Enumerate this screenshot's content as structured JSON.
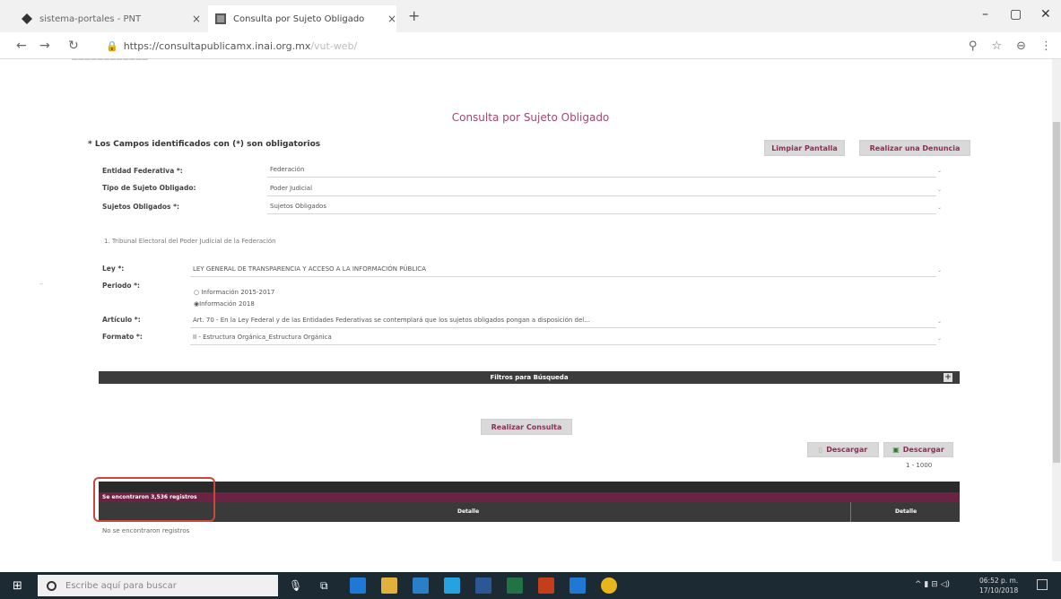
{
  "browser": {
    "tabs": [
      {
        "label": "sistema-portales - PNT"
      },
      {
        "label": "Consulta por Sujeto Obligado"
      }
    ],
    "url_main": "https://consultapublicamx.inai.org.mx",
    "url_path": "/vut-web/"
  },
  "page": {
    "title": "Consulta por Sujeto Obligado",
    "required_note": "* Los Campos identificados con (*) son obligatorios",
    "clear_button": "Limpiar Pantalla",
    "report_button": "Realizar una Denuncia",
    "fields": {
      "entidad": {
        "label": "Entidad Federativa *:",
        "value": "Federación"
      },
      "tipo": {
        "label": "Tipo de Sujeto Obligado:",
        "value": "Poder Judicial"
      },
      "sujetos": {
        "label": "Sujetos Obligados *:",
        "value": "Sujetos Obligados"
      },
      "ley": {
        "label": "Ley *:",
        "value": "LEY GENERAL DE TRANSPARENCIA Y ACCESO A LA INFORMACIÓN PÚBLICA"
      },
      "periodo": {
        "label": "Periodo *:",
        "option1": "Información 2015-2017",
        "option2": "Información 2018",
        "selected": "Información 2018"
      },
      "articulo": {
        "label": "Artículo *:",
        "value": "Art. 70 - En la Ley Federal y de las Entidades Federativas se contemplará que los sujetos obligados pongan a disposición del..."
      },
      "formato": {
        "label": "Formato *:",
        "value": "II - Estructura Orgánica_Estructura Orgánica"
      }
    },
    "selected_subject": "1. Tribunal Electoral del Poder Judicial de la Federación",
    "filters_label": "Filtros para Búsqueda",
    "query_button": "Realizar Consulta",
    "download1": "Descargar",
    "download2": "Descargar",
    "range": "1 - 1000",
    "results_count": "Se encontraron 3,536 registros",
    "col1": "Detalle",
    "col2": "Detalle",
    "no_records": "No se encontraron registros"
  },
  "taskbar": {
    "search_placeholder": "Escribe aquí para buscar",
    "time": "06:52 p. m.",
    "date": "17/10/2018"
  },
  "colors": {
    "accent_purple": "#6a2343",
    "title_pink": "#a24770",
    "highlight_red": "#c9473c"
  }
}
